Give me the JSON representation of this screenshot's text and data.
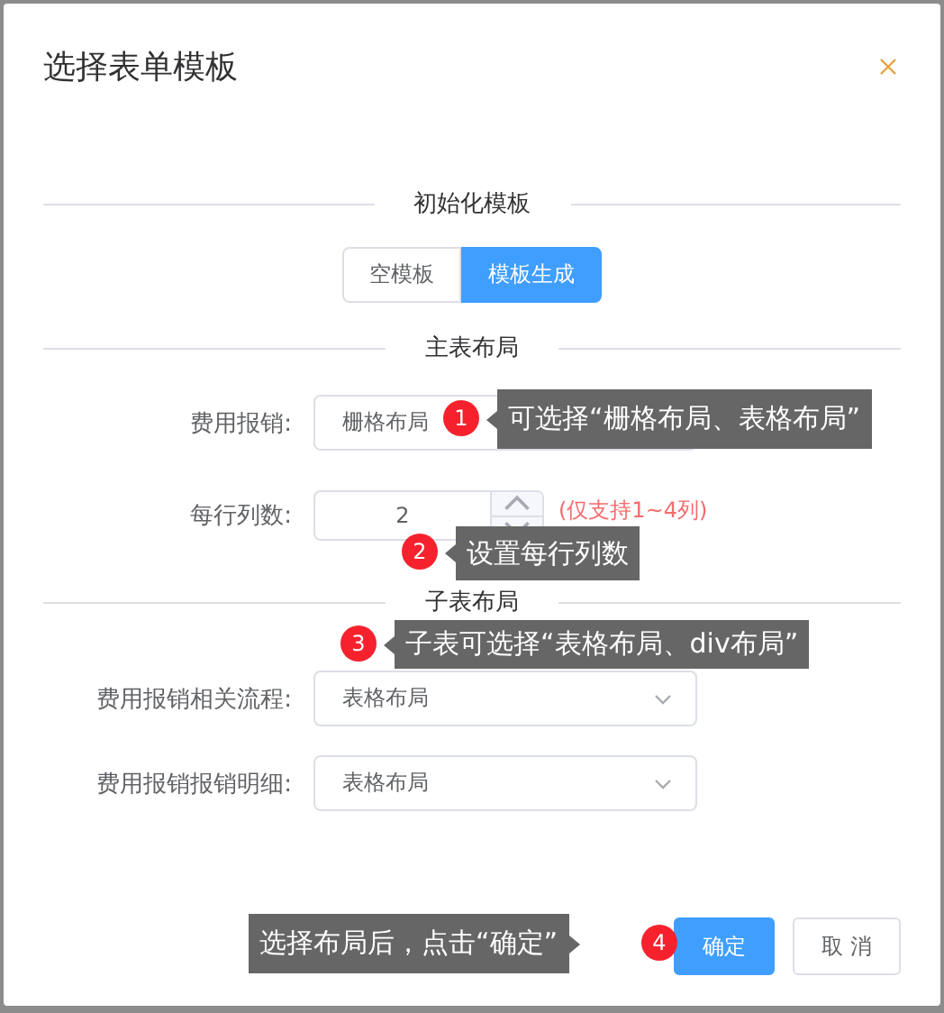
{
  "title": "选择表单模板",
  "init_template": {
    "heading": "初始化模板",
    "options": [
      {
        "label": "空模板",
        "selected": false
      },
      {
        "label": "模板生成",
        "selected": true
      }
    ]
  },
  "main_layout": {
    "heading": "主表布局",
    "fields": [
      {
        "kind": "input",
        "label": "费用报销:",
        "value": "栅格布局"
      },
      {
        "kind": "number",
        "label": "每行列数:",
        "value": "2",
        "hint": "(仅支持1~4列)"
      }
    ]
  },
  "sub_layout": {
    "heading": "子表布局",
    "fields": [
      {
        "kind": "select",
        "label": "费用报销相关流程:",
        "value": "表格布局"
      },
      {
        "kind": "select",
        "label": "费用报销报销明细:",
        "value": "表格布局"
      }
    ]
  },
  "buttons": [
    {
      "kind": "primary",
      "label": "确定"
    },
    {
      "kind": "default",
      "label": "取 消"
    }
  ],
  "callouts": [
    {
      "number": "1",
      "text": "可选择“栅格布局、表格布局”"
    },
    {
      "number": "2",
      "text": "设置每行列数"
    },
    {
      "number": "3",
      "text": "子表可选择“表格布局、div布局”"
    },
    {
      "number": "4",
      "text": "选择布局后，点击“确定”"
    }
  ]
}
